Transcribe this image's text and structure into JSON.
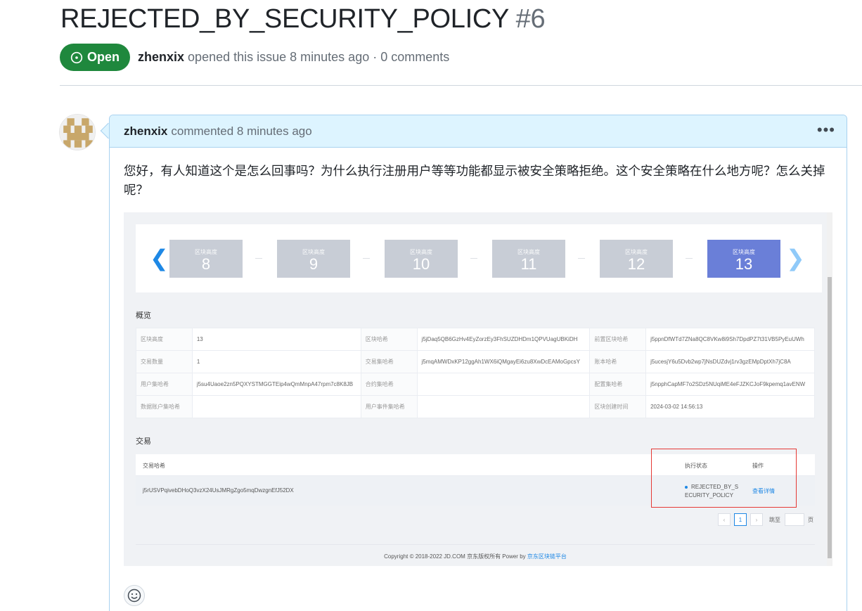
{
  "issue": {
    "title": "REJECTED_BY_SECURITY_POLICY",
    "number": "#6",
    "state": "Open",
    "author": "zhenxix",
    "meta_text": "opened this issue 8 minutes ago · 0 comments"
  },
  "comment": {
    "author": "zhenxix",
    "header_text": "commented 8 minutes ago",
    "body": "您好，有人知道这个是怎么回事吗？为什么执行注册用户等等功能都显示被安全策略拒绝。这个安全策略在什么地方呢？怎么关掉呢？"
  },
  "screenshot": {
    "blocks": [
      {
        "label": "区块高度",
        "value": "8",
        "active": false
      },
      {
        "label": "区块高度",
        "value": "9",
        "active": false
      },
      {
        "label": "区块高度",
        "value": "10",
        "active": false
      },
      {
        "label": "区块高度",
        "value": "11",
        "active": false
      },
      {
        "label": "区块高度",
        "value": "12",
        "active": false
      },
      {
        "label": "区块高度",
        "value": "13",
        "active": true
      }
    ],
    "overview_title": "概览",
    "overview": [
      [
        "区块高度",
        "13",
        "区块哈希",
        "j5jDaq5QB6GzHv4EyZorzEy3FhSUZDHDm1QPVUagUBKiDH",
        "前置区块哈希",
        "j5ppnDfWTd7ZNa8QC8VKw8i9Sh7DpdPZ7t31VB5PyEuUWh"
      ],
      [
        "交易数量",
        "1",
        "交易集哈希",
        "j5mqAMWDxKP12ggAh1WX6iQMgayEi6zu8XwDcEAMoGpcsY",
        "账本哈希",
        "j5ucesjY6u5Dvb2wp7jNsDUZdvj1rv3gzEMpDptXh7jC8A"
      ],
      [
        "用户集哈希",
        "j5su4Uaoe2zn5PQXYSTMGGTEip4wQmMnpA47rpm7c8K8JB",
        "合约集哈希",
        "",
        "配置集哈希",
        "j5npphCapMF7o2SDz5NUqiME4eFJZKCJoF9kpemq1avENW"
      ],
      [
        "数据账户集哈希",
        "",
        "用户事件集哈希",
        "",
        "区块创建时间",
        "2024-03-02 14:56:13"
      ]
    ],
    "tx_title": "交易",
    "tx_headers": {
      "hash": "交易哈希",
      "status": "执行状态",
      "action": "操作"
    },
    "tx_rows": [
      {
        "hash": "j5rUSVPqivebDHoQ3vzX24UsJMRgZgo5mqDwzgnEfJ52DX",
        "status_line1": "REJECTED_BY_S",
        "status_line2": "ECURITY_POLICY",
        "action": "查看详情"
      }
    ],
    "pagination": {
      "current": "1",
      "jump_label": "跳至",
      "page_suffix": "页"
    },
    "copyright_prefix": "Copyright © 2018-2022 JD.COM 京东版权所有 Power by",
    "copyright_link": "京东区块链平台"
  },
  "colors": {
    "open_green": "#1f883d",
    "comment_header_bg": "#ddf4ff",
    "active_block": "#6a7fd8",
    "highlight_box": "#e53935"
  }
}
